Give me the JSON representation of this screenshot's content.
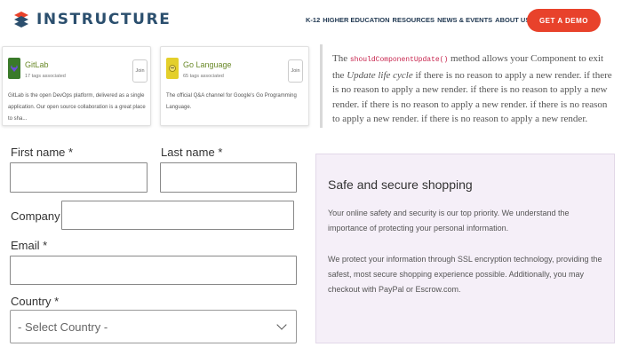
{
  "header": {
    "brand": "INSTRUCTURE",
    "nav": [
      {
        "label": "K-12"
      },
      {
        "label": "HIGHER EDUCATION"
      },
      {
        "label": "RESOURCES"
      },
      {
        "label": "NEWS & EVENTS"
      },
      {
        "label": "ABOUT US"
      }
    ],
    "cta_label": "GET A DEMO",
    "cta_color": "#e8422b"
  },
  "cards": [
    {
      "title": "GitLab",
      "subtitle": "17 tags associated",
      "join": "Join",
      "description_lines": [
        "GitLab is the open DevOps platform, delivered as a single",
        "application. Our open source collaboration is a great place to sha..."
      ]
    },
    {
      "title": "Go Language",
      "subtitle": "65 tags associated",
      "join": "Join",
      "description_lines": [
        "The official Q&A channel for Google's Go Programming Language."
      ]
    }
  ],
  "note": {
    "prefix": "The",
    "code": "shouldComponentUpdate()",
    "middle": "method allows your Component to exit the",
    "emphasis": "Update life cycle",
    "rest": "if there is no reason to apply a new render. if there is no reason to apply a new render. if there is no reason to apply a new render. if there is no reason to apply a new render. if there is no reason to apply a new render. if there is no reason to apply a new render."
  },
  "form": {
    "first_name_label": "First name *",
    "last_name_label": "Last name *",
    "company_label": "Company *",
    "email_label": "Email *",
    "country_label": "Country *",
    "country_value": "- Select Country -"
  },
  "secure": {
    "title": "Safe and secure shopping",
    "p1": "Your online safety and security is our top priority. We understand the importance of protecting your personal information.",
    "p2": "We protect your information through SSL encryption technology, providing the safest, most secure shopping experience possible. Additionally, you may checkout with PayPal or Escrow.com."
  }
}
